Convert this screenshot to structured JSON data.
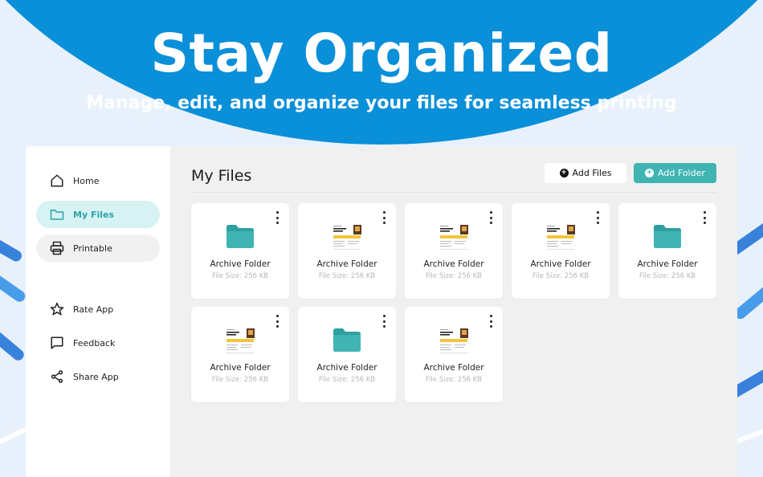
{
  "hero": {
    "title": "Stay Organized",
    "subtitle": "Manage, edit, and organize your files for seamless printing"
  },
  "colors": {
    "brand_blue": "#0a8fd9",
    "accent_teal": "#3fb4b3",
    "folder_teal": "#3aa9ab",
    "active_bg": "#d6f2f3"
  },
  "sidebar": {
    "items": [
      {
        "label": "Home",
        "icon": "home-icon"
      },
      {
        "label": "My Files",
        "icon": "folder-icon",
        "active": true
      },
      {
        "label": "Printable",
        "icon": "printer-icon"
      }
    ],
    "secondary": [
      {
        "label": "Rate App",
        "icon": "star-icon"
      },
      {
        "label": "Feedback",
        "icon": "feedback-icon"
      },
      {
        "label": "Share App",
        "icon": "share-icon"
      }
    ]
  },
  "main": {
    "title": "My Files",
    "add_files_label": "Add Files",
    "add_folder_label": "Add Folder",
    "files": [
      {
        "name": "Archive Folder",
        "size": "File Size: 256 KB",
        "type": "folder"
      },
      {
        "name": "Archive Folder",
        "size": "File Size: 256 KB",
        "type": "document"
      },
      {
        "name": "Archive Folder",
        "size": "File Size: 256 KB",
        "type": "document"
      },
      {
        "name": "Archive Folder",
        "size": "File Size: 256 KB",
        "type": "document"
      },
      {
        "name": "Archive Folder",
        "size": "File Size: 256 KB",
        "type": "folder"
      },
      {
        "name": "Archive Folder",
        "size": "File Size: 256 KB",
        "type": "document"
      },
      {
        "name": "Archive Folder",
        "size": "File Size: 256 KB",
        "type": "folder"
      },
      {
        "name": "Archive Folder",
        "size": "File Size: 256 KB",
        "type": "document"
      }
    ]
  }
}
